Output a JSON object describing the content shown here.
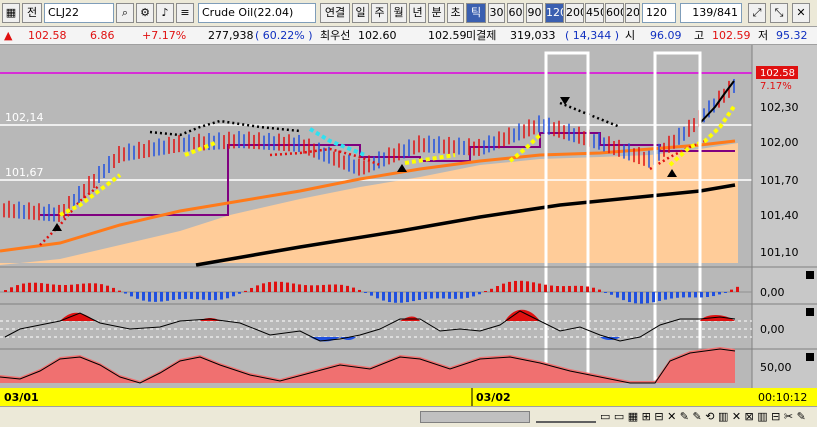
{
  "toolbar": {
    "leading_icon": "grid-icon",
    "type_label": "전",
    "code_value": "CLJ22",
    "instrument_value": "Crude Oil(22.04)",
    "period_buttons": [
      "연결",
      "일",
      "주",
      "월",
      "년",
      "분",
      "초",
      "틱"
    ],
    "interval_buttons": [
      "30",
      "60",
      "90",
      "120",
      "200",
      "450",
      "600",
      "20"
    ],
    "active_interval": "120",
    "interval_select": "120",
    "count_value": "139/841"
  },
  "quote": {
    "price": "102.58",
    "change": "6.86",
    "change_pct": "+7.17%",
    "volume": "277,938",
    "volume_ratio": "( 60.22% )",
    "best_ask_label": "최우선",
    "best_ask": "102.60",
    "best_bid": "102.59",
    "open_interest_label": "미결제",
    "open_interest": "319,033",
    "open_interest_change": "( 14,344 )",
    "open_label": "시",
    "open": "96.09",
    "high_label": "고",
    "high": "102.59",
    "low_label": "저",
    "low": "95.32"
  },
  "chart": {
    "price_axis_ticks": [
      "102,30",
      "102,00",
      "101,70",
      "101,40",
      "101,10"
    ],
    "current_price_tag": "102.58",
    "current_pct_tag": "7.17%",
    "left_labels": [
      "102,14",
      "101,67"
    ],
    "macd_axis": "0,00",
    "osc_axis": "0,00",
    "stoch_axis": "50,00",
    "date_labels": [
      "03/01",
      "03/02"
    ],
    "time_label": "00:10:12",
    "colors": {
      "up": "#e01010",
      "down": "#2050e0",
      "band_fill": "#ffcc99",
      "highlight": "#ffff00",
      "magenta": "#e000e0"
    }
  }
}
